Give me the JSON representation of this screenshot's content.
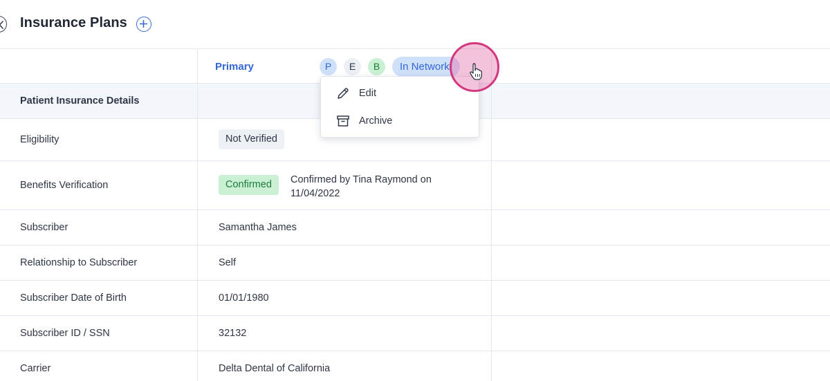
{
  "header": {
    "title": "Insurance Plans"
  },
  "plan": {
    "label": "Primary",
    "badges": [
      "P",
      "E",
      "B"
    ],
    "network": "In Network"
  },
  "menu": {
    "items": [
      {
        "label": "Edit",
        "icon": "pencil-icon"
      },
      {
        "label": "Archive",
        "icon": "archive-icon"
      }
    ]
  },
  "section": {
    "title": "Patient Insurance Details"
  },
  "rows": {
    "eligibility": {
      "label": "Eligibility",
      "value": "Not Verified"
    },
    "benefits": {
      "label": "Benefits Verification",
      "status": "Confirmed",
      "note": "Confirmed by Tina Raymond on 11/04/2022"
    },
    "subscriber": {
      "label": "Subscriber",
      "value": "Samantha James"
    },
    "relationship": {
      "label": "Relationship to Subscriber",
      "value": "Self"
    },
    "dob": {
      "label": "Subscriber Date of Birth",
      "value": "01/01/1980"
    },
    "subscriber_id": {
      "label": "Subscriber ID / SSN",
      "value": "32132"
    },
    "carrier": {
      "label": "Carrier",
      "value": "Delta Dental of California"
    }
  },
  "colors": {
    "accent": "#3466d6",
    "confirmed_bg": "#c9f0d3",
    "highlight": "#d4367d"
  }
}
